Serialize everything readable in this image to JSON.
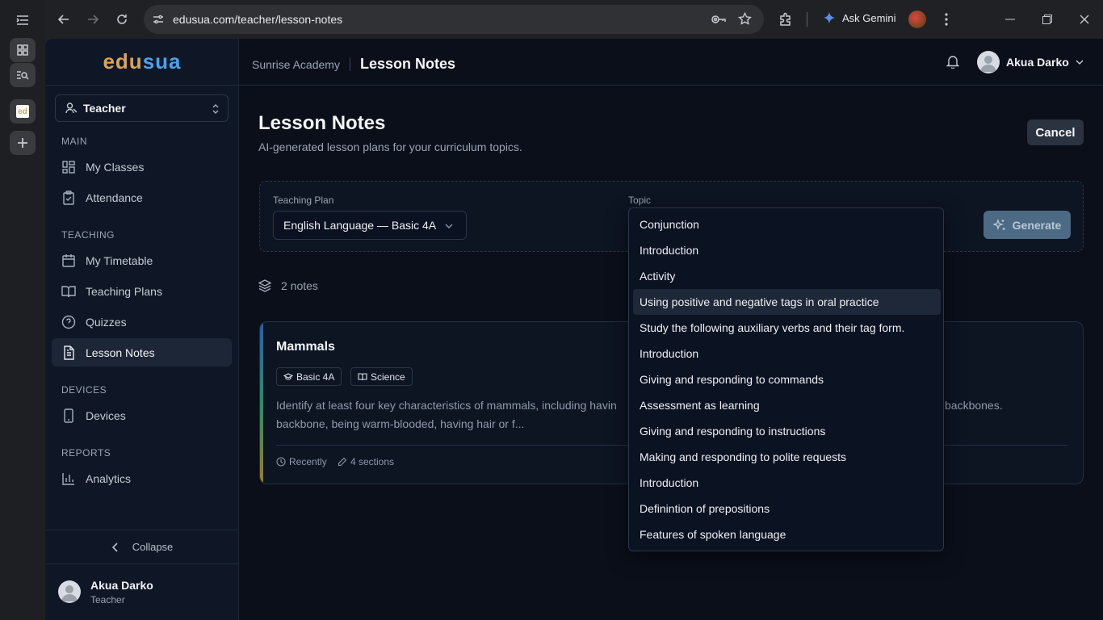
{
  "browser": {
    "url": "edusua.com/teacher/lesson-notes",
    "gemini_label": "Ask Gemini"
  },
  "sidebar": {
    "logo_a": "edu",
    "logo_b": "sua",
    "role": "Teacher",
    "sections": {
      "main": "MAIN",
      "teaching": "TEACHING",
      "devices": "DEVICES",
      "reports": "REPORTS"
    },
    "items": {
      "my_classes": "My Classes",
      "attendance": "Attendance",
      "my_timetable": "My Timetable",
      "teaching_plans": "Teaching Plans",
      "quizzes": "Quizzes",
      "lesson_notes": "Lesson Notes",
      "devices": "Devices",
      "analytics": "Analytics"
    },
    "collapse": "Collapse",
    "user_name": "Akua Darko",
    "user_role": "Teacher"
  },
  "header": {
    "school": "Sunrise Academy",
    "page": "Lesson Notes",
    "user_name": "Akua Darko"
  },
  "page": {
    "title": "Lesson Notes",
    "subtitle": "AI-generated lesson plans for your curriculum topics.",
    "cancel": "Cancel",
    "teaching_plan_label": "Teaching Plan",
    "teaching_plan_value": "English Language — Basic 4A",
    "topic_label": "Topic",
    "generate": "Generate",
    "notes_count": "2 notes"
  },
  "card": {
    "title": "Mammals",
    "chip_class": "Basic 4A",
    "chip_subject": "Science",
    "desc_left": "Identify at least four key characteristics of mammals, including havin",
    "desc_right": "backbones.",
    "desc_line2": "backbone, being warm-blooded, having hair or f...",
    "meta_time": "Recently",
    "meta_sections": "4 sections"
  },
  "topic_options": [
    "Conjunction",
    "Introduction",
    "Activity",
    "Using positive and negative tags in oral practice",
    "Study the following auxiliary verbs and their tag form.",
    "Introduction",
    "Giving and responding to commands",
    "Assessment as learning",
    "Giving and responding to instructions",
    "Making and responding to polite requests",
    "Introduction",
    "Definintion of prepositions",
    "Features of spoken language"
  ],
  "highlighted_option_index": 3
}
